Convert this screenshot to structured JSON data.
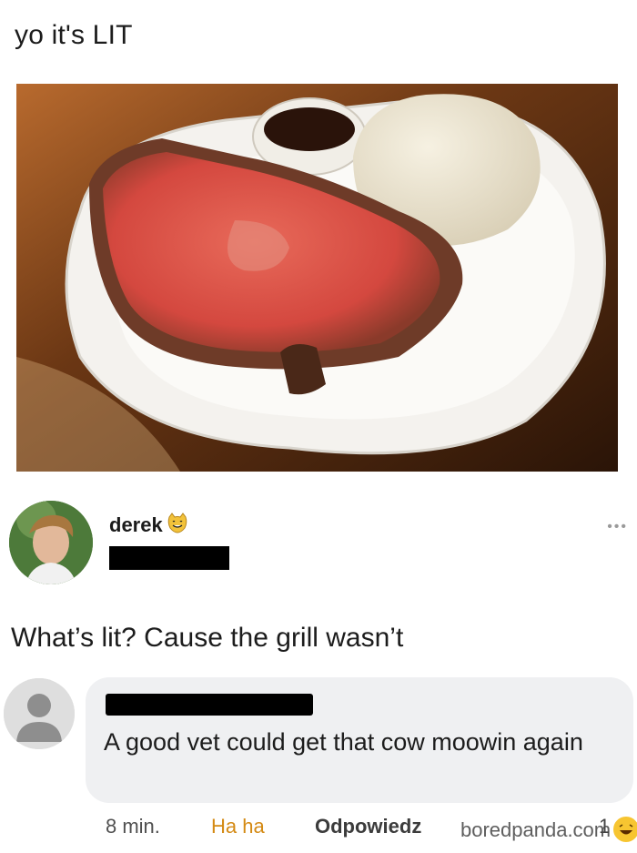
{
  "post": {
    "caption": "yo it's LIT"
  },
  "user": {
    "name": "derek",
    "emoji": "smiling-cat-icon"
  },
  "post_text": "What’s lit? Cause the grill wasn’t",
  "comment": {
    "text": "A good vet could get that cow moowin again",
    "time": "8 min.",
    "reaction": "Ha ha",
    "reply": "Odpowiedz",
    "reaction_count": "1",
    "watermark": "boredpanda.com"
  },
  "icons": {
    "more": "more-dots-icon",
    "default_avatar": "user-silhouette-icon",
    "reaction": "laughing-face-icon"
  }
}
